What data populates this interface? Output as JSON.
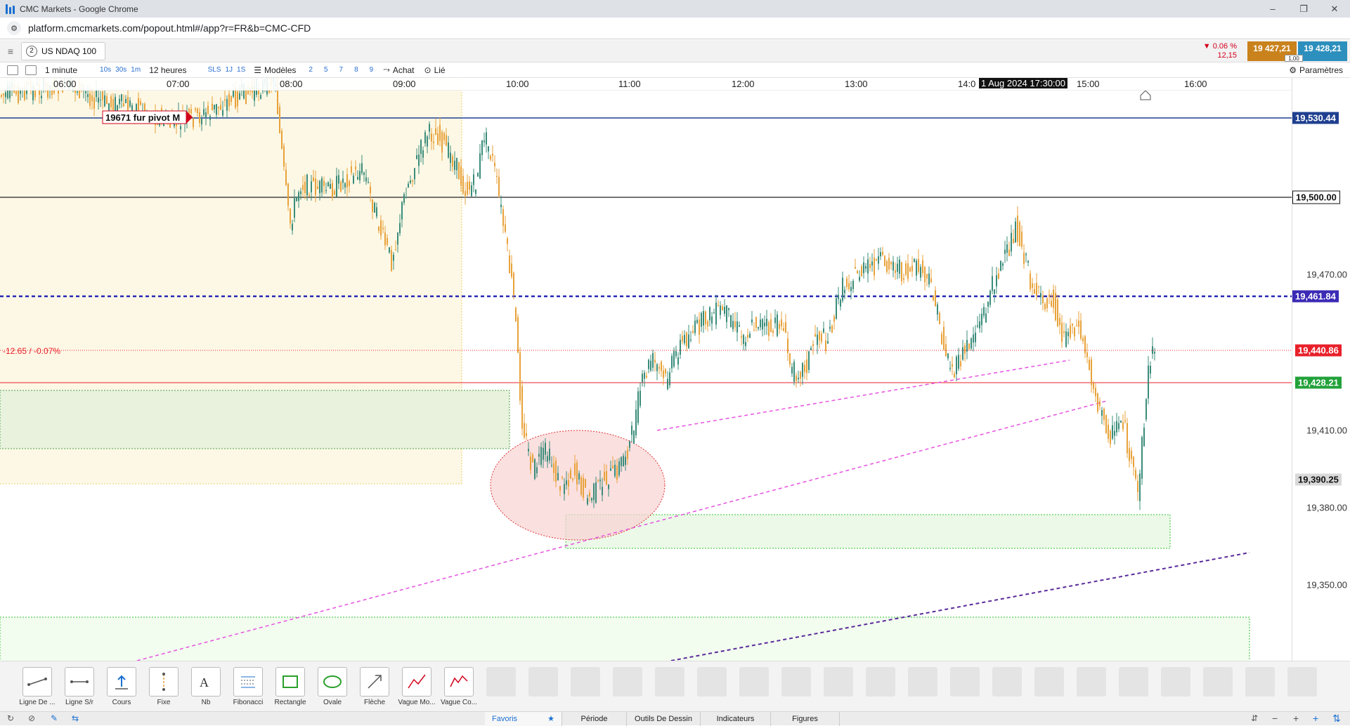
{
  "window": {
    "title": "CMC Markets - Google Chrome",
    "buttons": [
      "–",
      "❐",
      "✕"
    ]
  },
  "browser": {
    "url": "platform.cmcmarkets.com/popout.html#/app?r=FR&b=CMC-CFD"
  },
  "instrument": {
    "tab_number": "2",
    "name": "US NDAQ 100",
    "change_pct": "▼ 0.06 %",
    "change_abs": "12,15",
    "sell_price": "19 427,21",
    "buy_price": "19 428,21",
    "spread": "1,00"
  },
  "toolbar": {
    "timeframe": "1 minute",
    "quick_intervals": [
      "10s",
      "30s",
      "1m"
    ],
    "range": "12 heures",
    "range_quick": [
      "SLS",
      "1J",
      "1S"
    ],
    "models": "Modèles",
    "model_slots": [
      "2",
      "5",
      "7",
      "8",
      "9"
    ],
    "order": "Achat",
    "link": "Lié",
    "settings": "Paramètres"
  },
  "time_axis": {
    "labels": [
      "06:00",
      "07:00",
      "08:00",
      "09:00",
      "10:00",
      "11:00",
      "12:00",
      "13:00",
      "15:00",
      "16:00"
    ],
    "cursor_label": "1 Aug 2024 17:30:00",
    "cursor_prefix": "14:0"
  },
  "price_axis": {
    "ticks": [
      "19,470.00",
      "19,410.00",
      "19,380.00",
      "19,350.00"
    ],
    "tags": {
      "pivot": "19,530.44",
      "round": "19,500.00",
      "dotted": "19,461.84",
      "reference": "19,440.86",
      "current": "19,428.21",
      "cursor": "19,390.25"
    }
  },
  "annotations": {
    "pivot_label": "19671 fur pivot M",
    "change_label": "-12.65 / -0.07%"
  },
  "colors": {
    "pivot_line": "#1f3f8f",
    "dotted_line": "#2727b5",
    "reference_line": "#e8202a",
    "current_tag": "#22a13a",
    "candle_up": "#3a8c7a",
    "candle_down": "#e8a23a",
    "trend_pink": "#e652e0",
    "trend_purple": "#5a2a9a"
  },
  "drawing_tools": [
    {
      "label": "Ligne De ...",
      "icon": "line-tool-icon"
    },
    {
      "label": "Ligne S/r",
      "icon": "sr-line-icon"
    },
    {
      "label": "Cours",
      "icon": "price-marker-icon"
    },
    {
      "label": "Fixe",
      "icon": "fixed-line-icon"
    },
    {
      "label": "Nb",
      "icon": "text-note-icon"
    },
    {
      "label": "Fibonacci",
      "icon": "fibonacci-icon"
    },
    {
      "label": "Rectangle",
      "icon": "rectangle-icon"
    },
    {
      "label": "Ovale",
      "icon": "oval-icon"
    },
    {
      "label": "Flèche",
      "icon": "arrow-icon"
    },
    {
      "label": "Vague Mo...",
      "icon": "wave-motive-icon"
    },
    {
      "label": "Vague Co...",
      "icon": "wave-corrective-icon"
    }
  ],
  "bottom_tabs": {
    "favoris": "Favoris",
    "periode": "Période",
    "outils": "Outils De Dessin",
    "indicateurs": "Indicateurs",
    "figures": "Figures"
  },
  "zoom_controls": [
    "−",
    "+"
  ]
}
